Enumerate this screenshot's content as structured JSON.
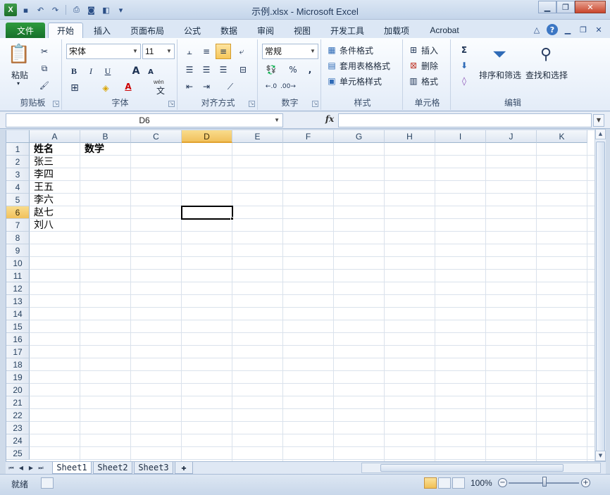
{
  "window": {
    "title": "示例.xlsx - Microsoft Excel",
    "minimize_glyph": "▁",
    "maximize_glyph": "❐",
    "close_glyph": "✕"
  },
  "qat": {
    "logo": "X",
    "save_glyph": "▪",
    "undo_glyph": "↶",
    "redo_glyph": "↷",
    "print_glyph": "⎙",
    "camera_glyph": "◙",
    "preview_glyph": "◧",
    "customize_glyph": "▾"
  },
  "tabs": {
    "file": "文件",
    "home": "开始",
    "insert": "插入",
    "page_layout": "页面布局",
    "formulas": "公式",
    "data": "数据",
    "review": "审阅",
    "view": "视图",
    "developer": "开发工具",
    "addins": "加载项",
    "acrobat": "Acrobat"
  },
  "tab_icons": {
    "collapse": "△",
    "help": "?",
    "min": "▁",
    "restore": "❐",
    "close": "✕"
  },
  "ribbon": {
    "clipboard": {
      "label": "剪贴板",
      "paste": "粘贴",
      "paste_glyph": "▾",
      "cut_glyph": "✂",
      "copy_glyph": "⧉",
      "format_painter_glyph": "🖌"
    },
    "font": {
      "label": "字体",
      "font_name": "宋体",
      "font_size": "11",
      "bold": "B",
      "italic": "I",
      "underline": "U",
      "grow": "A",
      "shrink": "A",
      "border_glyph": "⊞",
      "fill_glyph": "◈",
      "color_glyph": "A",
      "phonetic": "wén",
      "phonetic_char": "文"
    },
    "alignment": {
      "label": "对齐方式"
    },
    "number": {
      "label": "数字",
      "format": "常规",
      "percent": "%",
      "comma": ","
    },
    "styles": {
      "label": "样式",
      "conditional": "条件格式",
      "as_table": "套用表格格式",
      "cell_styles": "单元格样式"
    },
    "cells": {
      "label": "单元格",
      "insert": "插入",
      "delete": "删除",
      "format": "格式"
    },
    "editing": {
      "label": "编辑",
      "sum_glyph": "Σ",
      "sort_filter": "排序和筛选",
      "find_select": "查找和选择"
    }
  },
  "formula_bar": {
    "name_box": "D6",
    "fx": "fx",
    "formula": ""
  },
  "grid": {
    "columns": [
      "A",
      "B",
      "C",
      "D",
      "E",
      "F",
      "G",
      "H",
      "I",
      "J",
      "K"
    ],
    "rows": [
      "1",
      "2",
      "3",
      "4",
      "5",
      "6",
      "7",
      "8",
      "9",
      "10",
      "11",
      "12",
      "13",
      "14",
      "15",
      "16",
      "17",
      "18",
      "19",
      "20",
      "21",
      "22",
      "23",
      "24",
      "25"
    ],
    "selected_column": "D",
    "selected_row": "6",
    "cells": {
      "A1": "姓名",
      "B1": "数学",
      "A2": "张三",
      "A3": "李四",
      "A4": "王五",
      "A5": "李六",
      "A6": "赵七",
      "A7": "刘八"
    }
  },
  "sheets": [
    "Sheet1",
    "Sheet2",
    "Sheet3"
  ],
  "active_sheet": "Sheet1",
  "status": {
    "mode": "就绪",
    "zoom": "100%",
    "zoom_out": "−",
    "zoom_in": "+"
  },
  "colors": {
    "file_tab": "#16702a",
    "selected_header": "#f1c15c",
    "active_cell_border": "#000000"
  }
}
